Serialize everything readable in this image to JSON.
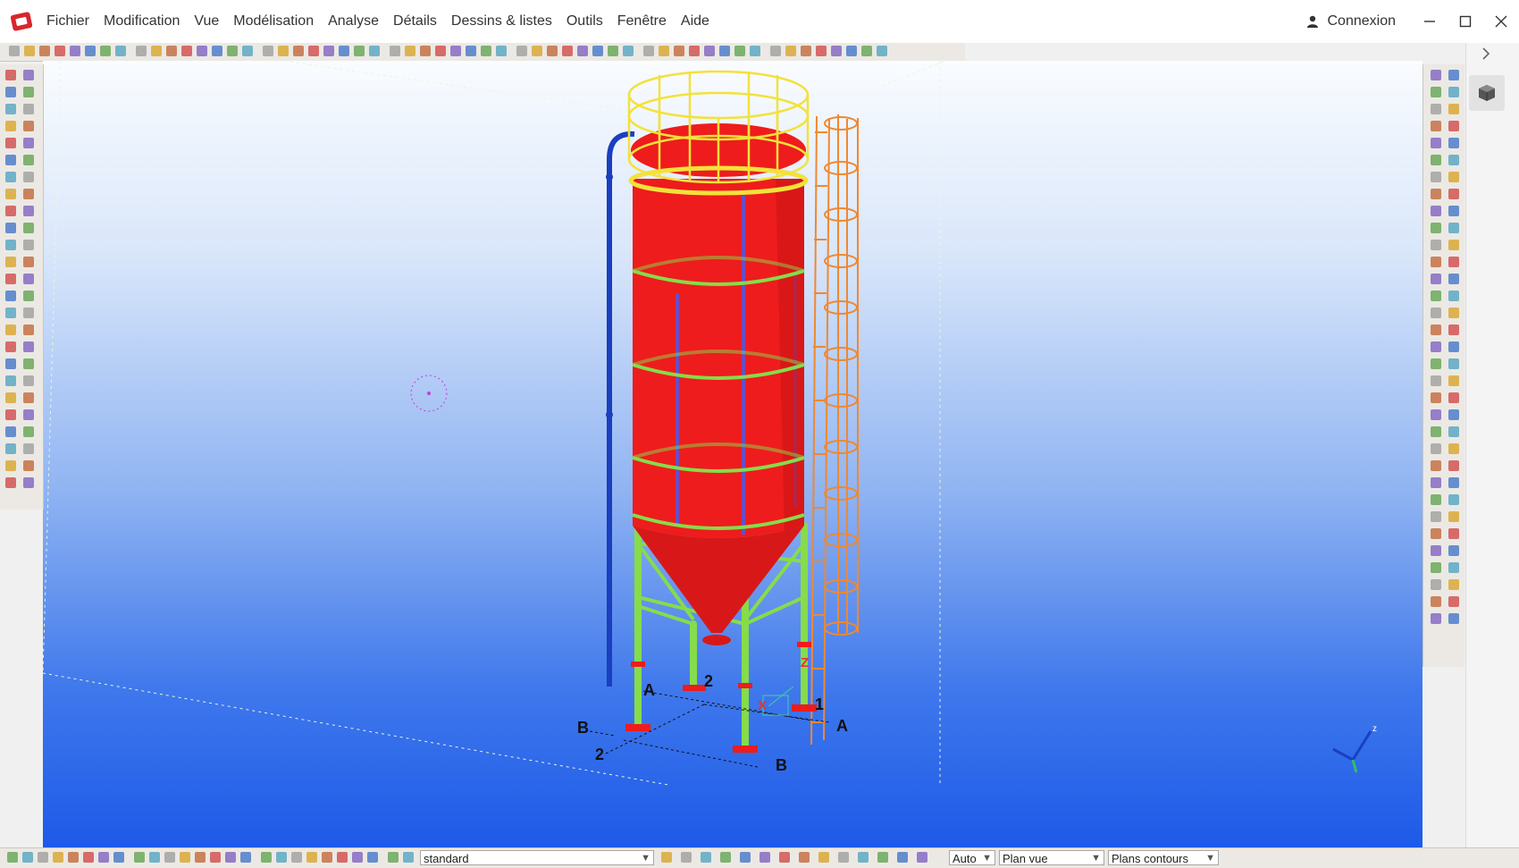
{
  "menu": {
    "items": [
      "Fichier",
      "Modification",
      "Vue",
      "Modélisation",
      "Analyse",
      "Détails",
      "Dessins & listes",
      "Outils",
      "Fenêtre",
      "Aide"
    ]
  },
  "account": {
    "login_label": "Connexion"
  },
  "viewport": {
    "grid_labels": {
      "a_left": "A",
      "a_right": "A",
      "b_left": "B",
      "b_bottom": "B",
      "two_top": "2",
      "two_left": "2",
      "one": "1",
      "axis_z": "Z",
      "axis_x": "X"
    }
  },
  "statusbar": {
    "style_combo": "standard",
    "mode_combo": "Auto",
    "view_plane_combo": "Plan vue",
    "contour_combo": "Plans contours"
  },
  "colors": {
    "silo_body": "#ee1c1c",
    "silo_shadow": "#a80f0f",
    "legs": "#86dc4a",
    "railing": "#f2e23a",
    "ladder": "#f08830",
    "pipe": "#1a3fbf",
    "background_top": "#fafcff",
    "background_bottom": "#1d5ae8"
  },
  "icons": {
    "logo": "tekla-logo-icon",
    "user": "user-icon",
    "minimize": "minimize-icon",
    "maximize": "maximize-icon",
    "close": "close-icon",
    "side_chevron": "chevron-right-icon",
    "view_cube": "view-cube-icon"
  }
}
